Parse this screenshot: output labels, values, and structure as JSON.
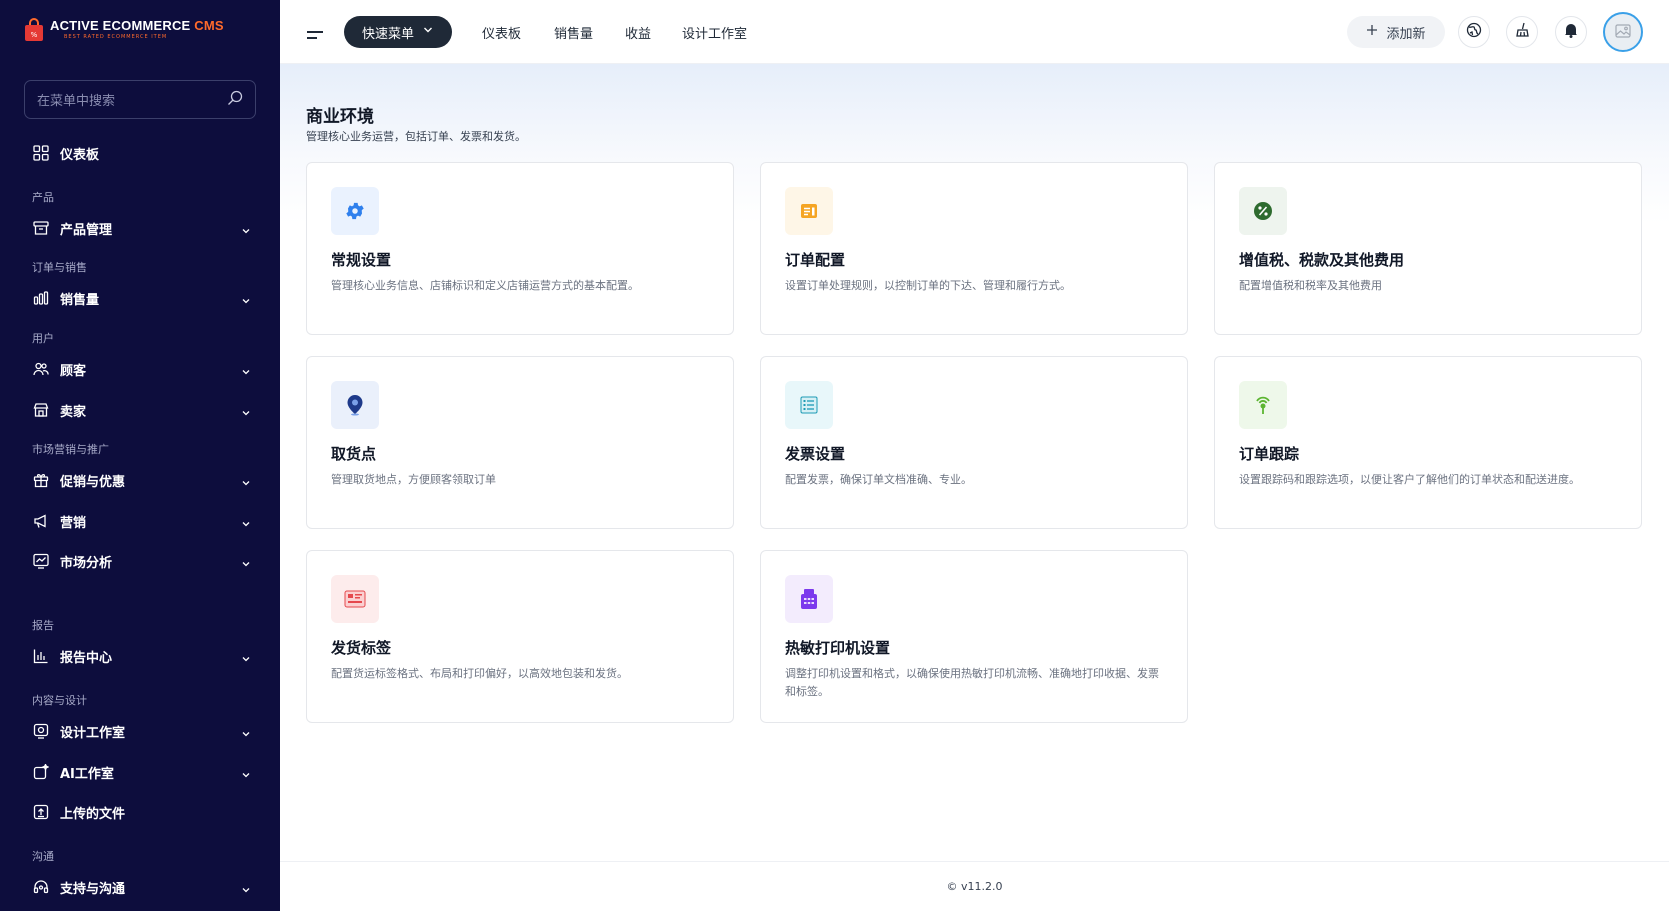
{
  "brand": {
    "title_main": "ACTIVE ECOMMERCE",
    "title_accent": "CMS",
    "tagline": "BEST RATED ECOMMERCE ITEM"
  },
  "sidebar": {
    "search_placeholder": "在菜单中搜索",
    "dashboard": "仪表板",
    "sections": {
      "products": "产品",
      "orders_sales": "订单与销售",
      "users": "用户",
      "marketing": "市场营销与推广",
      "reports": "报告",
      "content_design": "内容与设计",
      "communication": "沟通"
    },
    "items": {
      "product_management": "产品管理",
      "sales": "销售量",
      "customers": "顾客",
      "sellers": "卖家",
      "promotions": "促销与优惠",
      "marketing": "营销",
      "market_analysis": "市场分析",
      "report_center": "报告中心",
      "design_studio": "设计工作室",
      "ai_studio": "AI工作室",
      "uploaded_files": "上传的文件",
      "support": "支持与沟通"
    }
  },
  "topbar": {
    "quick_menu": "快速菜单",
    "links": [
      "仪表板",
      "销售量",
      "收益",
      "设计工作室"
    ],
    "add_new": "添加新"
  },
  "page": {
    "title": "商业环境",
    "subtitle": "管理核心业务运营，包括订单、发票和发货。"
  },
  "cards": [
    {
      "title": "常规设置",
      "desc": "管理核心业务信息、店铺标识和定义店铺运营方式的基本配置。",
      "icon": "gear-icon",
      "color": "#2f80ed",
      "bg": "#eaf2fe"
    },
    {
      "title": "订单配置",
      "desc": "设置订单处理规则，以控制订单的下达、管理和履行方式。",
      "icon": "order-icon",
      "color": "#f5a524",
      "bg": "#fef6e7"
    },
    {
      "title": "增值税、税款及其他费用",
      "desc": "配置增值税和税率及其他费用",
      "icon": "percent-icon",
      "color": "#2e6b2f",
      "bg": "#eef4ee"
    },
    {
      "title": "取货点",
      "desc": "管理取货地点，方便顾客领取订单",
      "icon": "location-pin-icon",
      "color": "#1e3a8a",
      "bg": "#eaf0fb"
    },
    {
      "title": "发票设置",
      "desc": "配置发票，确保订单文档准确、专业。",
      "icon": "invoice-icon",
      "color": "#1d9bb5",
      "bg": "#e8f7fa"
    },
    {
      "title": "订单跟踪",
      "desc": "设置跟踪码和跟踪选项，以便让客户了解他们的订单状态和配送进度。",
      "icon": "tracking-icon",
      "color": "#5cb531",
      "bg": "#eef8ea"
    },
    {
      "title": "发货标签",
      "desc": "配置货运标签格式、布局和打印偏好，以高效地包装和发货。",
      "icon": "shipping-label-icon",
      "color": "#e5484d",
      "bg": "#fdecec"
    },
    {
      "title": "热敏打印机设置",
      "desc": "调整打印机设置和格式，以确保使用热敏打印机流畅、准确地打印收据、发票和标签。",
      "icon": "printer-icon",
      "color": "#7c3aed",
      "bg": "#f3ecfd"
    }
  ],
  "footer": {
    "version": "© v11.2.0"
  },
  "colors": {
    "sidebar_bg": "#0d0d3d",
    "brand_accent": "#ff6a2b",
    "quick_menu_bg": "#1f2937"
  }
}
